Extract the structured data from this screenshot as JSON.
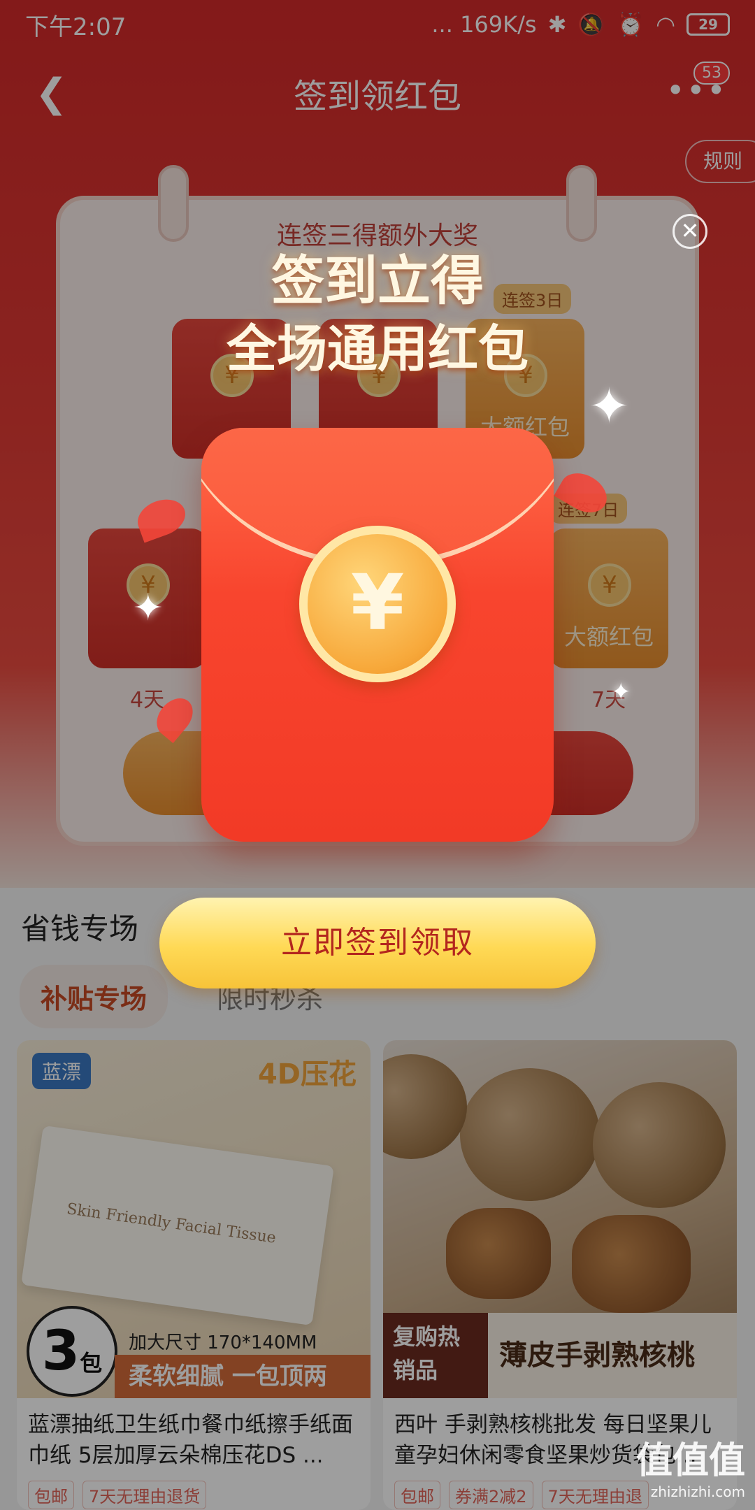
{
  "status_bar": {
    "time": "下午2:07",
    "network_speed": "... 169K/s",
    "battery": "29"
  },
  "nav": {
    "title": "签到领红包",
    "badge_count": "53"
  },
  "rules_button": "规则",
  "calendar": {
    "subtitle": "连签三得额外大奖",
    "streak_tag_3": "连签3日",
    "streak_tag_7": "连签7日",
    "big_packet_label": "大额红包",
    "day4": "4天",
    "day7": "7天"
  },
  "section": {
    "title": "省钱专场",
    "tabs": [
      {
        "label": "补贴专场",
        "active": true
      },
      {
        "label": "限时秒杀",
        "active": false
      }
    ]
  },
  "products": [
    {
      "brand": "蓝漂",
      "badge": "4D压花",
      "image_text": "Skin Friendly Facial Tissue",
      "count": "3",
      "count_unit": "包",
      "size": "加大尺寸 170*140MM",
      "banner": "柔软细腻 一包顶两",
      "title": "蓝漂抽纸卫生纸巾餐巾纸擦手纸面巾纸 5层加厚云朵棉压花DS ...",
      "chips": [
        "包邮",
        "7天无理由退货"
      ]
    },
    {
      "left_label": "复购热销品",
      "right_label": "薄皮手剥熟核桃",
      "title": "西叶 手剥熟核桃批发 每日坚果儿童孕妇休闲零食坚果炒货袋包...",
      "chips": [
        "包邮",
        "券满2减2",
        "7天无理由退"
      ]
    }
  ],
  "modal": {
    "heading_line1": "签到立得",
    "heading_line2": "全场通用红包",
    "coin_symbol": "¥",
    "cta": "立即签到领取"
  },
  "watermark": {
    "main": "值值值",
    "sub": "zhizhizhi.com"
  },
  "colors": {
    "primary_red": "#e13a34",
    "cta_yellow": "#ffd955",
    "cta_text": "#b3261e"
  }
}
